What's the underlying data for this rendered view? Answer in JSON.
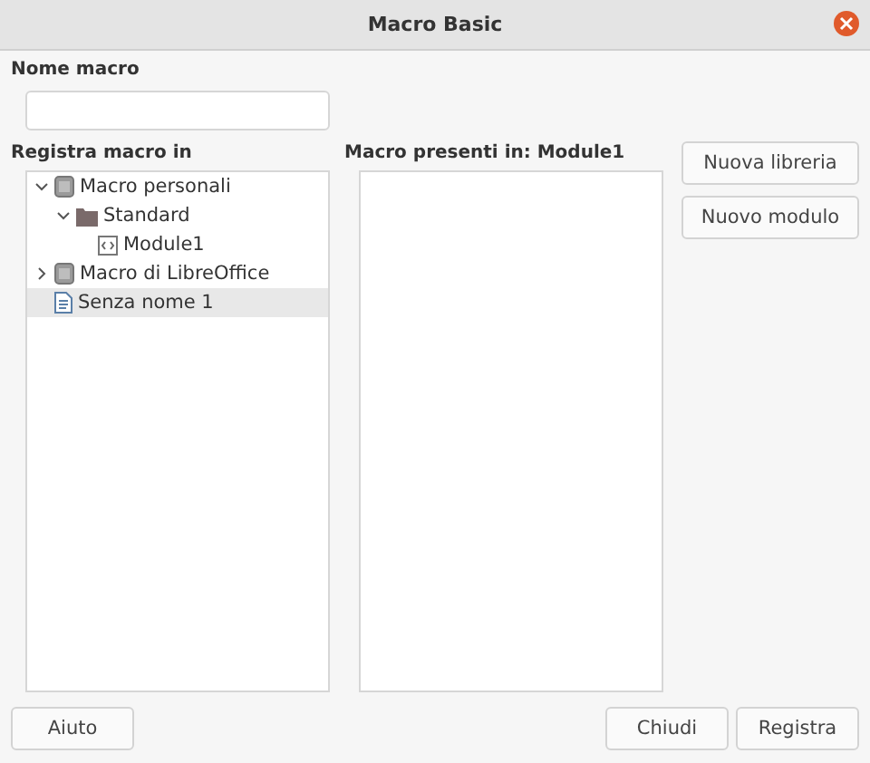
{
  "window": {
    "title": "Macro Basic"
  },
  "macro_name": {
    "label": "Nome macro"
  },
  "save_in": {
    "label": "Registra macro in",
    "tree": [
      {
        "label": "Macro personali",
        "kind": "library",
        "expanded": true,
        "selected": false,
        "children": [
          {
            "label": "Standard",
            "kind": "folder",
            "expanded": true,
            "selected": false,
            "children": [
              {
                "label": "Module1",
                "kind": "module",
                "selected": false
              }
            ]
          }
        ]
      },
      {
        "label": "Macro di LibreOffice",
        "kind": "library",
        "expanded": false,
        "selected": false
      },
      {
        "label": "Senza nome 1",
        "kind": "document",
        "selected": true
      }
    ]
  },
  "macros": {
    "label": "Macro presenti in: Module1"
  },
  "side_buttons": [
    "Nuova libreria",
    "Nuovo modulo"
  ],
  "footer": {
    "help": "Aiuto",
    "buttons": [
      "Chiudi",
      "Registra"
    ]
  }
}
